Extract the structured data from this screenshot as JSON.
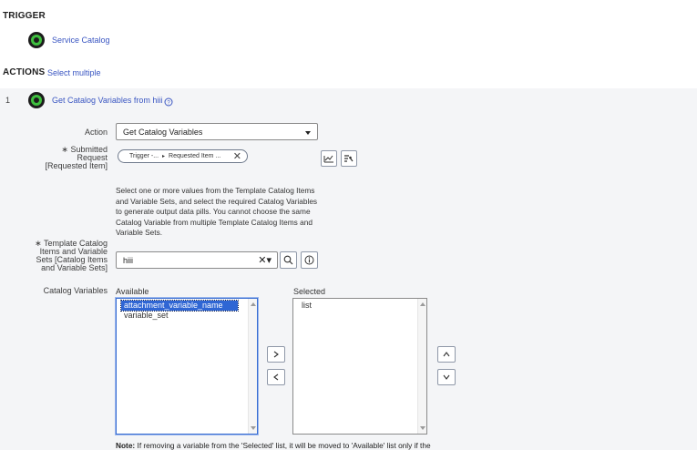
{
  "trigger": {
    "heading": "TRIGGER",
    "item_label": "Service Catalog"
  },
  "actions": {
    "heading": "ACTIONS",
    "select_multiple": "Select multiple",
    "step_number": "1",
    "step_title": "Get Catalog Variables from hiii"
  },
  "form": {
    "action_label": "Action",
    "action_value": "Get Catalog Variables",
    "submitted_request_label": "∗ Submitted Request [Requested Item]",
    "pill_trigger": "Trigger -...",
    "pill_requested_item": "Requested Item ...",
    "help_text": "Select one or more values from the Template Catalog Items and Variable Sets, and select the required Catalog Variables to generate output data pills. You cannot choose the same Catalog Variable from multiple Template Catalog Items and Variable Sets.",
    "template_label": "∗ Template Catalog Items and Variable Sets [Catalog Items and Variable Sets]",
    "template_value": "hiii",
    "catalog_variables_label": "Catalog Variables",
    "available_label": "Available",
    "selected_label": "Selected",
    "available_items": [
      "attachment_variable_name",
      "variable_set"
    ],
    "selected_items": [
      "list"
    ],
    "note_bold": "Note:",
    "note_text": " If removing a variable from the 'Selected' list, it will be moved to 'Available' list only if the"
  },
  "colors": {
    "link": "#3a56c2",
    "panel_bg": "#f4f5f7",
    "selection": "#2f66d4",
    "step_icon_ring": "#3fbf3f"
  }
}
